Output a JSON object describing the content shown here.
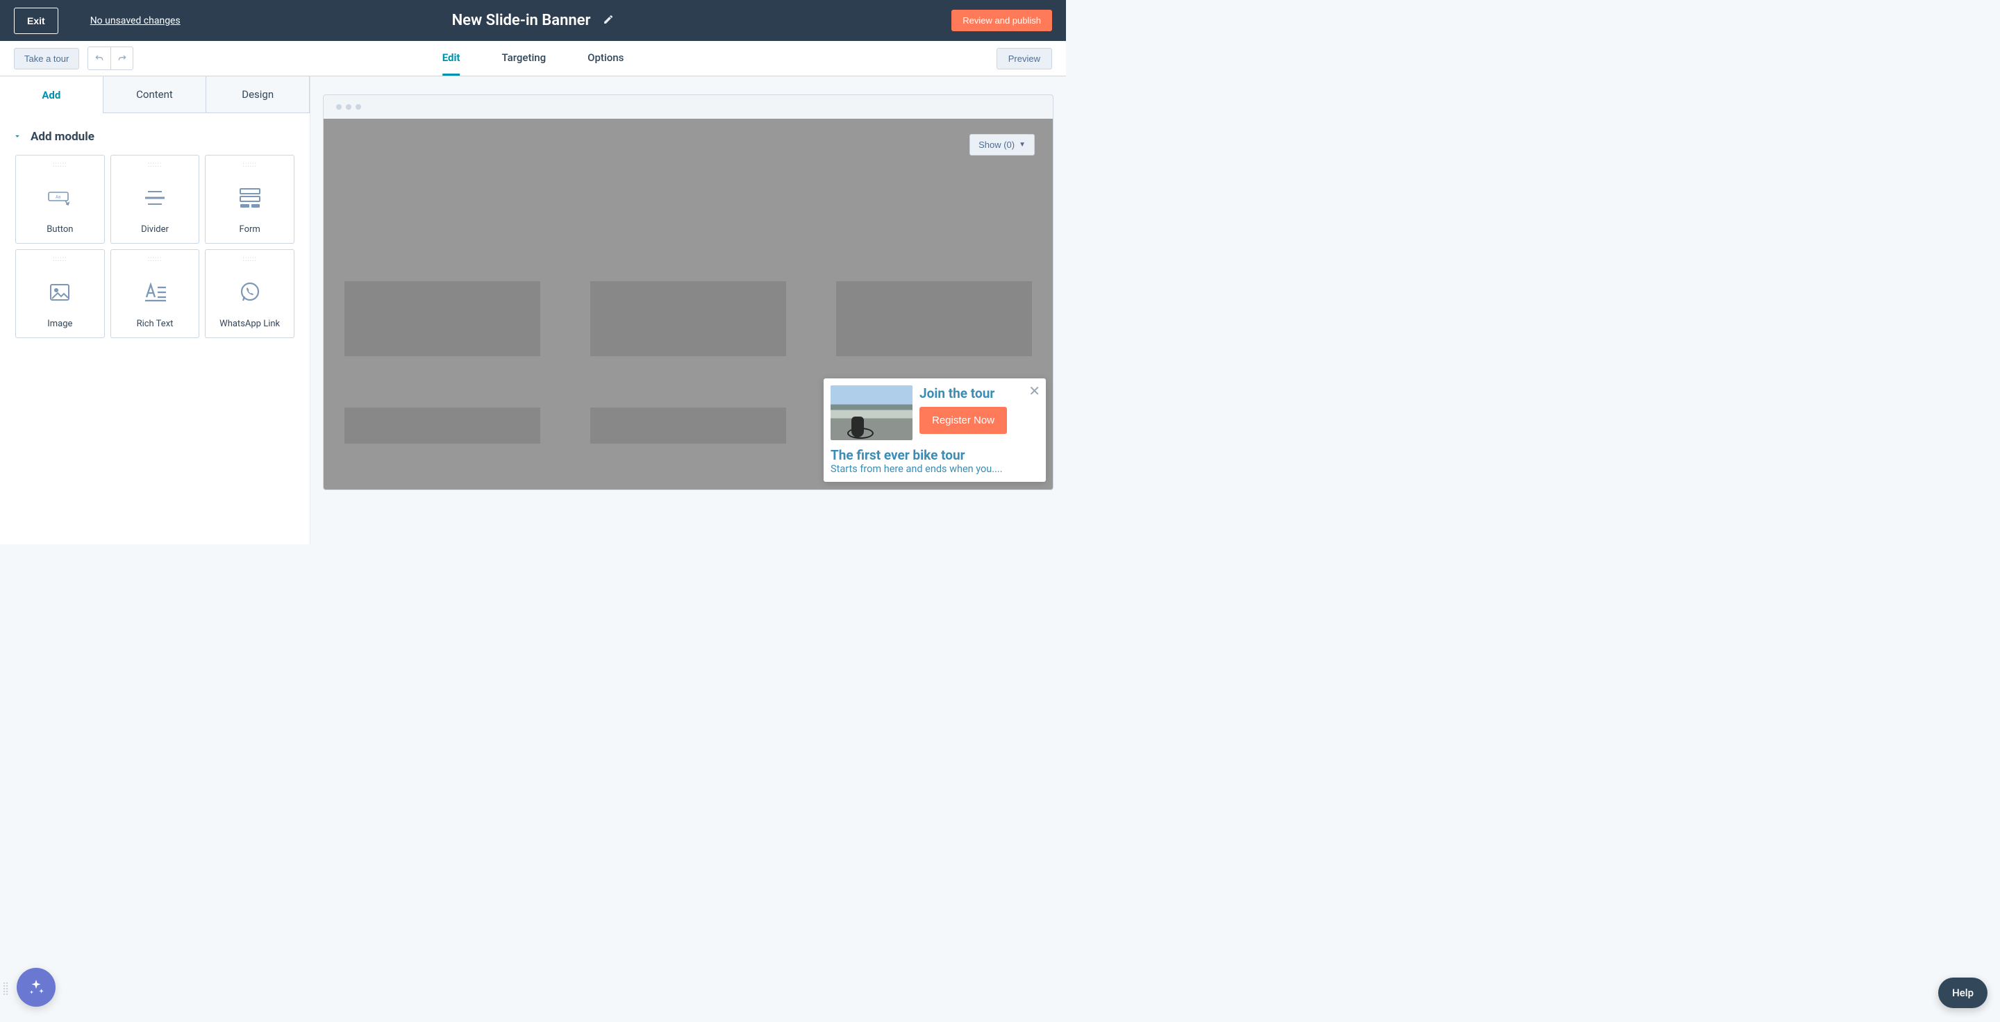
{
  "header": {
    "exit": "Exit",
    "unsaved": "No unsaved changes",
    "title": "New Slide-in Banner",
    "publish": "Review and publish"
  },
  "subheader": {
    "take_tour": "Take a tour",
    "tabs": {
      "edit": "Edit",
      "targeting": "Targeting",
      "options": "Options"
    },
    "preview": "Preview"
  },
  "sidebar": {
    "tabs": {
      "add": "Add",
      "content": "Content",
      "design": "Design"
    },
    "section_title": "Add module",
    "modules": {
      "button": "Button",
      "divider": "Divider",
      "form": "Form",
      "image": "Image",
      "richtext": "Rich Text",
      "whatsapp": "WhatsApp Link"
    }
  },
  "canvas": {
    "show_label": "Show (0)"
  },
  "banner": {
    "join": "Join the tour",
    "cta": "Register Now",
    "headline": "The first ever bike tour",
    "sub": "Starts from here and ends when you...."
  },
  "help": "Help"
}
